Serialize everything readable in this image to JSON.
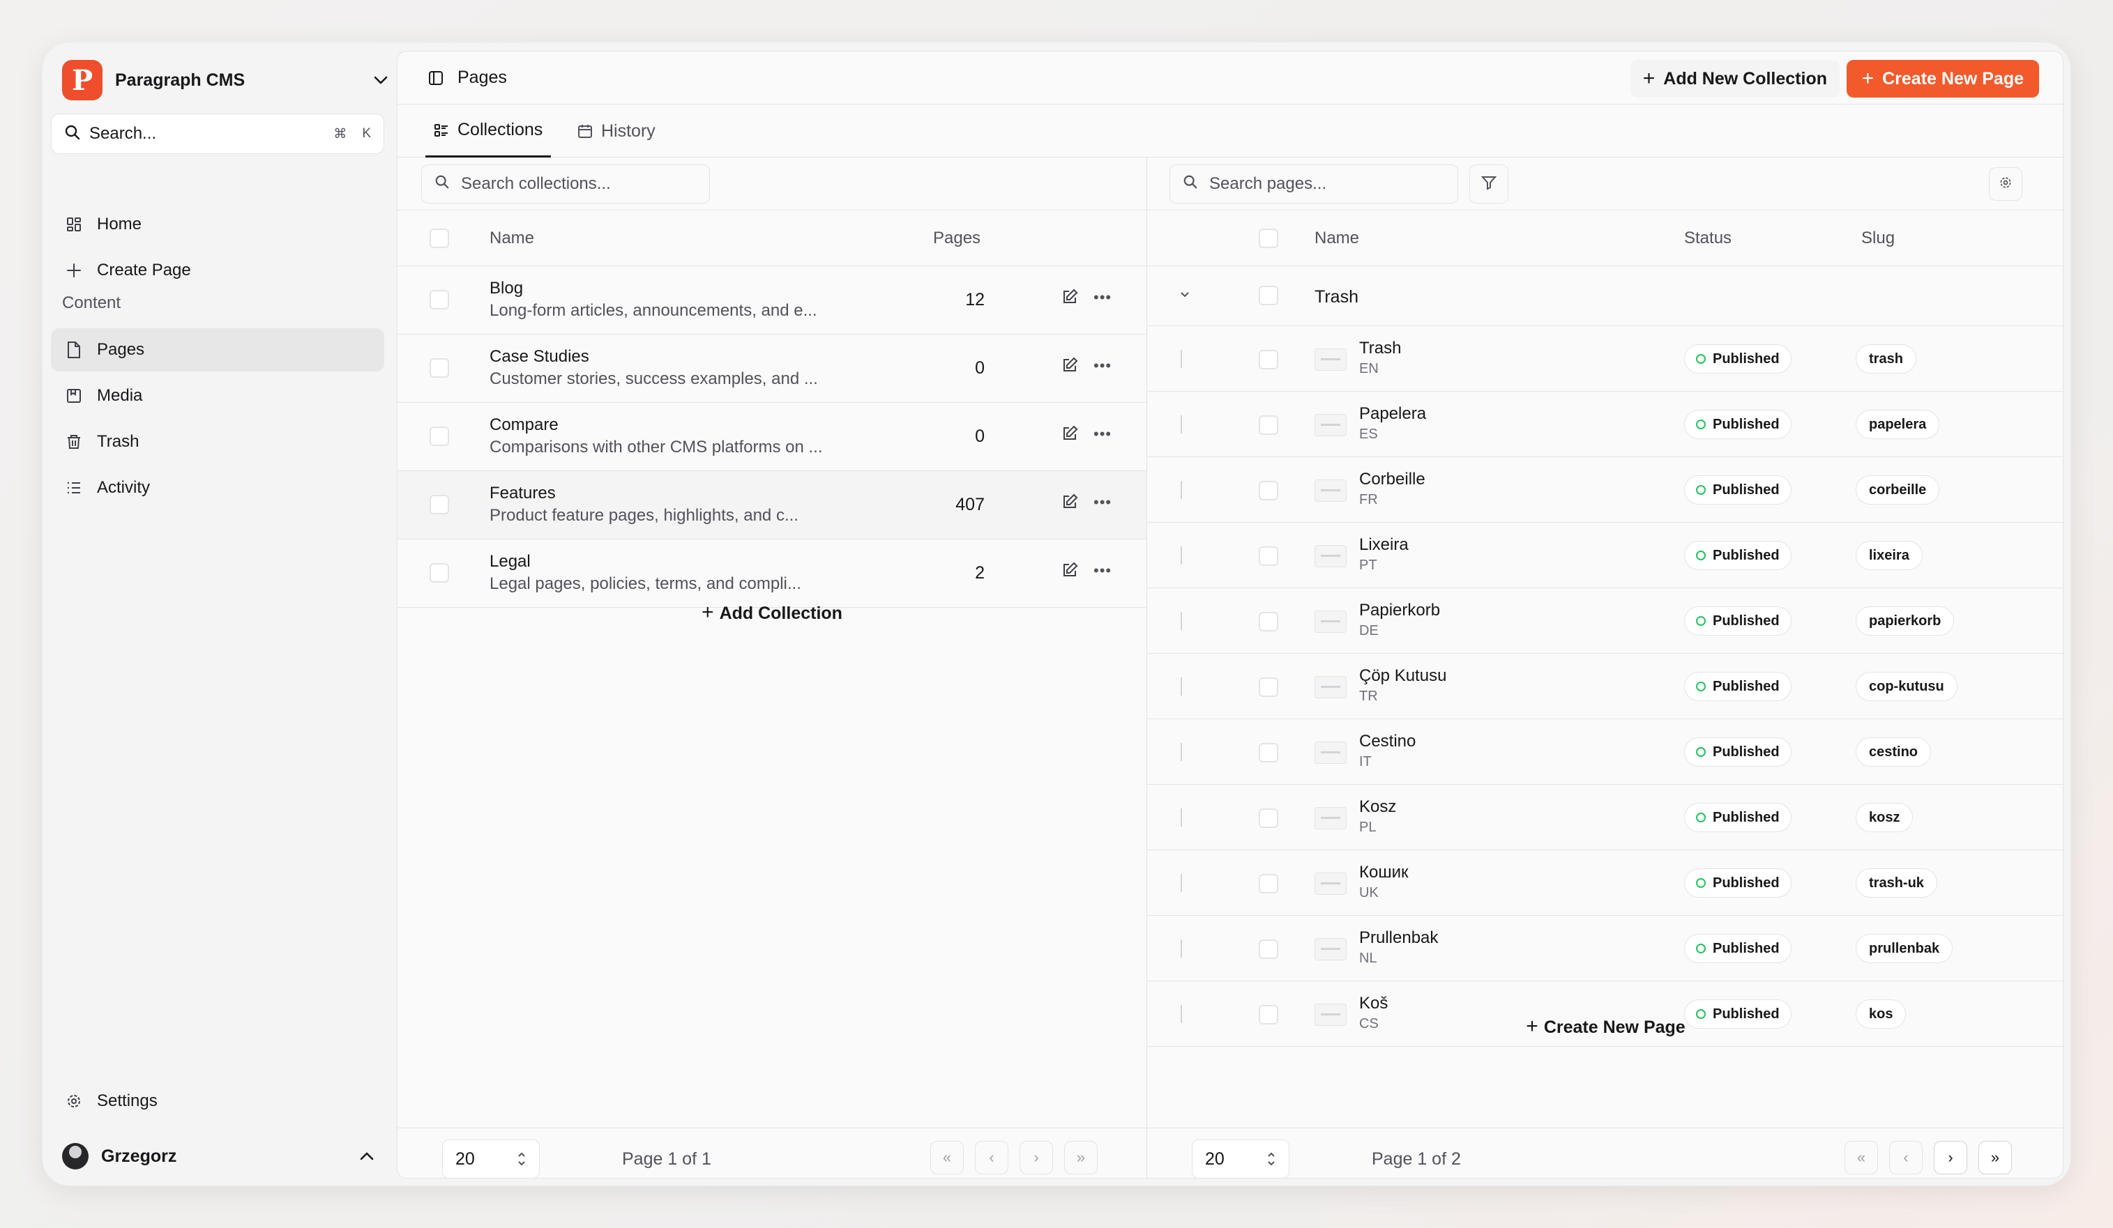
{
  "sidebar": {
    "brand_name": "Paragraph CMS",
    "search_label": "Search...",
    "search_shortcut_cmd": "⌘",
    "search_shortcut_key": "K",
    "nav": {
      "home": "Home",
      "create_page": "Create Page",
      "section_content": "Content",
      "pages": "Pages",
      "media": "Media",
      "trash": "Trash",
      "activity": "Activity",
      "settings": "Settings"
    },
    "user_name": "Grzegorz"
  },
  "header": {
    "title": "Pages",
    "add_collection_label": "Add New Collection",
    "create_page_label": "Create New Page"
  },
  "tabs": {
    "collections": "Collections",
    "history": "History"
  },
  "collections": {
    "search_placeholder": "Search collections...",
    "col_name": "Name",
    "col_pages": "Pages",
    "rows": [
      {
        "name": "Blog",
        "desc": "Long-form articles, announcements, and e...",
        "count": "12"
      },
      {
        "name": "Case Studies",
        "desc": "Customer stories, success examples, and ...",
        "count": "0"
      },
      {
        "name": "Compare",
        "desc": "Comparisons with other CMS platforms on ...",
        "count": "0"
      },
      {
        "name": "Features",
        "desc": "Product feature pages, highlights, and c...",
        "count": "407"
      },
      {
        "name": "Legal",
        "desc": "Legal pages, policies, terms, and compli...",
        "count": "2"
      }
    ],
    "add_label": "Add Collection",
    "page_size": "20",
    "page_info": "Page 1 of 1"
  },
  "pages": {
    "search_placeholder": "Search pages...",
    "col_name": "Name",
    "col_status": "Status",
    "col_slug": "Slug",
    "group_name": "Trash",
    "rows": [
      {
        "name": "Trash",
        "lang": "EN",
        "status": "Published",
        "slug": "trash"
      },
      {
        "name": "Papelera",
        "lang": "ES",
        "status": "Published",
        "slug": "papelera"
      },
      {
        "name": "Corbeille",
        "lang": "FR",
        "status": "Published",
        "slug": "corbeille"
      },
      {
        "name": "Lixeira",
        "lang": "PT",
        "status": "Published",
        "slug": "lixeira"
      },
      {
        "name": "Papierkorb",
        "lang": "DE",
        "status": "Published",
        "slug": "papierkorb"
      },
      {
        "name": "Çöp Kutusu",
        "lang": "TR",
        "status": "Published",
        "slug": "cop-kutusu"
      },
      {
        "name": "Cestino",
        "lang": "IT",
        "status": "Published",
        "slug": "cestino"
      },
      {
        "name": "Kosz",
        "lang": "PL",
        "status": "Published",
        "slug": "kosz"
      },
      {
        "name": "Кошик",
        "lang": "UK",
        "status": "Published",
        "slug": "trash-uk"
      },
      {
        "name": "Prullenbak",
        "lang": "NL",
        "status": "Published",
        "slug": "prullenbak"
      },
      {
        "name": "Koš",
        "lang": "CS",
        "status": "Published",
        "slug": "kos"
      }
    ],
    "create_label": "Create New Page",
    "page_size": "20",
    "page_info": "Page 1 of 2"
  },
  "colors": {
    "accent": "#f25a2c",
    "published": "#22c55e"
  }
}
